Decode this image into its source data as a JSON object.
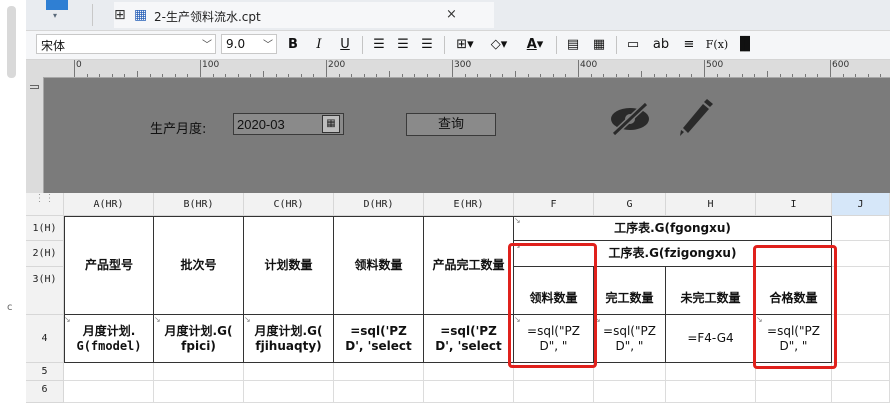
{
  "tab": {
    "title": "2-生产领料流水.cpt",
    "close": "×"
  },
  "toolbar": {
    "font_name": "宋体",
    "font_size": "9.0",
    "bold": "B",
    "italic": "I",
    "underline": "U",
    "text_color_letter": "A",
    "ab_label": "ab",
    "fx_label": "F(x)"
  },
  "ruler": {
    "marks": [
      "0",
      "100",
      "200",
      "300",
      "400",
      "500",
      "600"
    ]
  },
  "params": {
    "month_label": "生产月度:",
    "month_value": "2020-03",
    "query_button": "查询"
  },
  "sheet": {
    "columns": [
      "A(HR)",
      "B(HR)",
      "C(HR)",
      "D(HR)",
      "E(HR)",
      "F",
      "G",
      "H",
      "I",
      "J"
    ],
    "rows": [
      "1(H)",
      "2(H)",
      "3(H)",
      "4",
      "5",
      "6"
    ],
    "cells": {
      "a_header": "产品型号",
      "b_header": "批次号",
      "c_header": "计划数量",
      "d_header": "领料数量",
      "e_header": "产品完工数量",
      "fg_row1": "工序表.G(fgongxu)",
      "fg_row2": "工序表.G(fzigongxu)",
      "f3": "领料数量",
      "g3": "完工数量",
      "h3": "未完工数量",
      "i3": "合格数量",
      "a4_line1": "月度计划.",
      "a4_line2": "G(fmodel)",
      "b4_line1": "月度计划.G(",
      "b4_line2": "fpici)",
      "c4_line1": "月度计划.G(",
      "c4_line2": "fjihuaqty)",
      "d4_line1": "=sql('PZ",
      "d4_line2": "D', 'select",
      "e4_line1": "=sql('PZ",
      "e4_line2": "D', 'select",
      "f4_line1": "=sql(\"PZ",
      "f4_line2": "D\", \"",
      "g4_line1": "=sql(\"PZ",
      "g4_line2": "D\", \"",
      "h4": "=F4-G4",
      "i4_line1": "=sql(\"PZ",
      "i4_line2": "D\", \""
    }
  },
  "colors": {
    "highlight": "#e0211c",
    "param_bg": "#7b7b7b",
    "selected_col": "#d6e7f9"
  }
}
